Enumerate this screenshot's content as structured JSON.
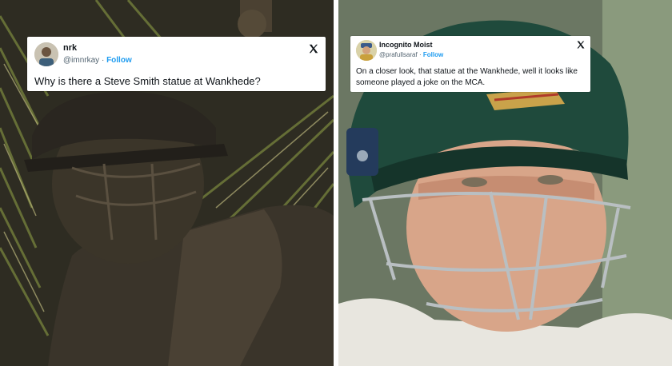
{
  "tweets": [
    {
      "name": "nrk",
      "handle": "@imnrkay",
      "separator": "·",
      "follow_label": "Follow",
      "text": "Why is there a Steve Smith statue at Wankhede?",
      "avatar_icon": "user-avatar",
      "logo_icon": "x-logo-icon"
    },
    {
      "name": "Incognito Moist",
      "handle": "@prafullsaraf",
      "separator": "·",
      "follow_label": "Follow",
      "text": "On a closer look, that statue at the Wankhede, well it looks like someone played a joke on the MCA.",
      "avatar_icon": "user-avatar",
      "logo_icon": "x-logo-icon"
    }
  ],
  "colors": {
    "follow": "#1d9bf0",
    "name": "#0f1419",
    "handle": "#536471",
    "helmet": "#1f4a3c"
  }
}
